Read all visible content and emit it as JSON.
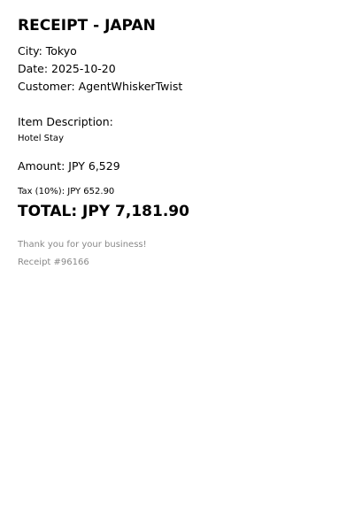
{
  "receipt": {
    "title": "RECEIPT - JAPAN",
    "city": "City: Tokyo",
    "date": "Date: 2025-10-20",
    "customer": "Customer: AgentWhiskerTwist",
    "item_heading": "Item Description:",
    "item_value": "Hotel Stay",
    "amount": "Amount: JPY 6,529",
    "tax": "Tax (10%): JPY 652.90",
    "total": "TOTAL: JPY 7,181.90",
    "thanks": "Thank you for your business!",
    "receipt_number": "Receipt #96166"
  }
}
